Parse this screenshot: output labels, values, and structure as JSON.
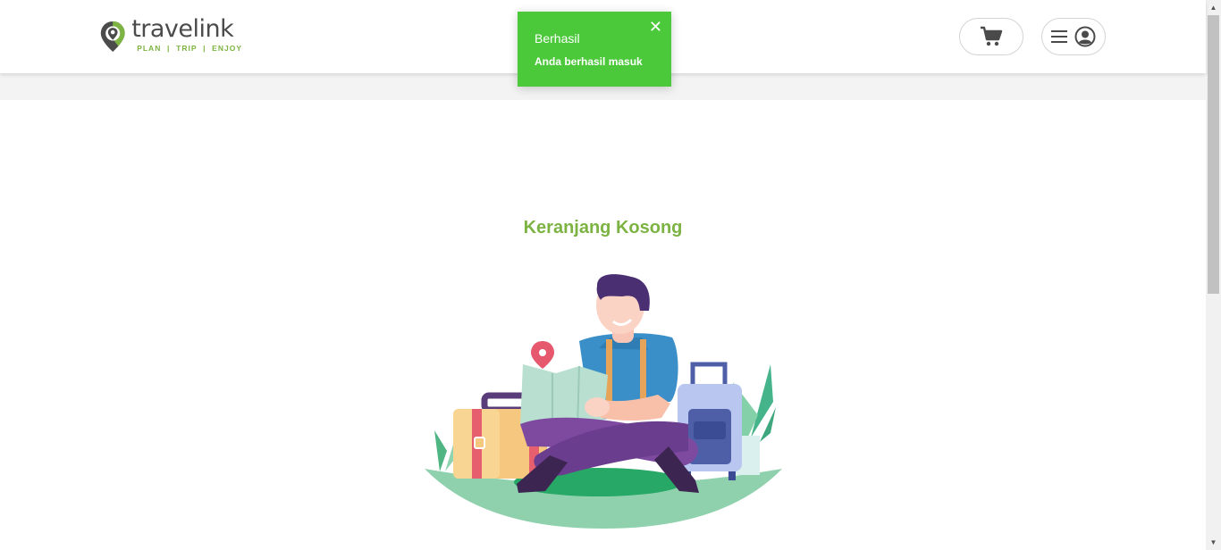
{
  "header": {
    "logo": {
      "word": "travelink",
      "tagline": "PLAN  |  TRIP  |  ENJOY"
    },
    "icons": {
      "cart": "shopping-cart-icon",
      "menu": "hamburger-menu-icon",
      "user": "user-circle-icon"
    }
  },
  "toast": {
    "title": "Berhasil",
    "message": "Anda berhasil masuk",
    "close_label": "✕",
    "color": "#4cc93a"
  },
  "main": {
    "empty_title": "Keranjang Kosong"
  },
  "colors": {
    "brand_green": "#7cb342",
    "logo_dark": "#4b4b4b"
  }
}
